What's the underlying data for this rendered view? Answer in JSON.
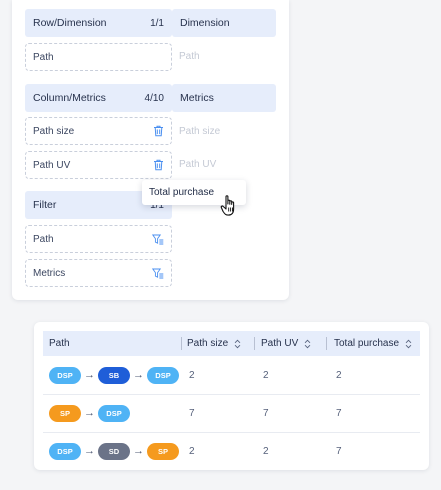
{
  "config": {
    "row_dimension": {
      "label": "Row/Dimension",
      "count": "1/1",
      "fields": [
        "Path"
      ]
    },
    "dimension": {
      "label": "Dimension",
      "placeholder": "Path"
    },
    "column_metrics": {
      "label": "Column/Metrics",
      "count": "4/10",
      "fields": [
        "Path size",
        "Path UV"
      ]
    },
    "metrics": {
      "label": "Metrics",
      "placeholders": [
        "Path size",
        "Path UV"
      ]
    },
    "filter": {
      "label": "Filter",
      "count": "1/1",
      "fields": [
        "Path",
        "Metrics"
      ]
    },
    "drag_tooltip": "Total purchase"
  },
  "table": {
    "headers": [
      "Path",
      "Path size",
      "Path UV",
      "Total purchase"
    ],
    "rows": [
      {
        "path": [
          "DSP",
          "SB",
          "DSP"
        ],
        "path_size": "2",
        "path_uv": "2",
        "total_purchase": "2"
      },
      {
        "path": [
          "SP",
          "DSP"
        ],
        "path_size": "7",
        "path_uv": "7",
        "total_purchase": "7"
      },
      {
        "path": [
          "DSP",
          "SD",
          "SP"
        ],
        "path_size": "2",
        "path_uv": "2",
        "total_purchase": "7"
      }
    ]
  },
  "chip_colors": {
    "DSP": "#4fb3f5",
    "SB": "#1f5ed8",
    "SP": "#f59a1e",
    "SD": "#6b7388"
  },
  "icons": {
    "delete": "trash-icon",
    "filter": "filter-icon",
    "sort": "sort-icon",
    "cursor": "hand-pointer-icon",
    "arrow": "arrow-right-icon"
  }
}
